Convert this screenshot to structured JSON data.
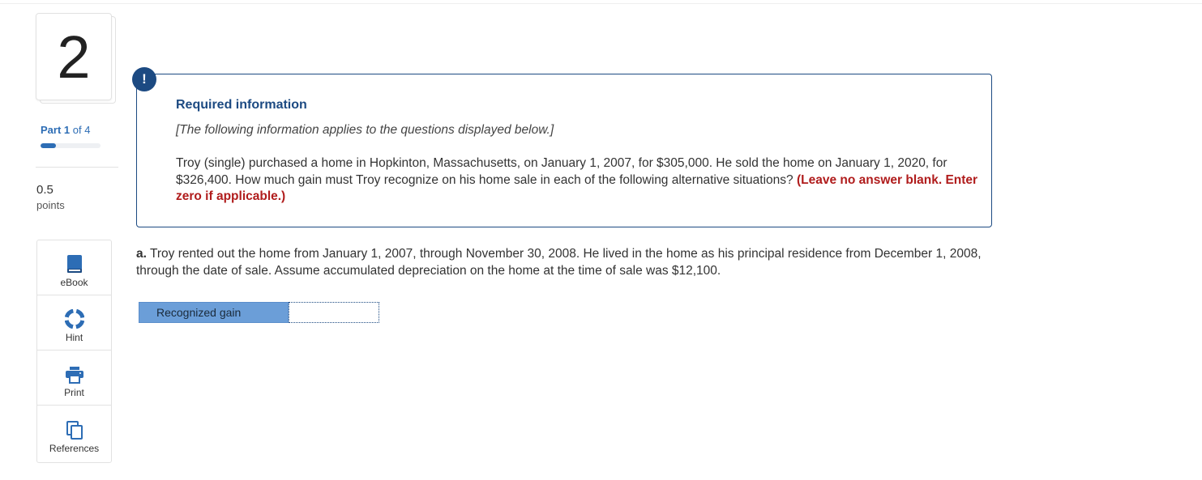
{
  "sidebar": {
    "question_number": "2",
    "part_current": "1",
    "part_of_label": "of 4",
    "part_prefix": "Part",
    "progress_fraction": 0.25,
    "points_value": "0.5",
    "points_label": "points",
    "tools": [
      {
        "label": "eBook",
        "icon": "book-icon"
      },
      {
        "label": "Hint",
        "icon": "lifebuoy-icon"
      },
      {
        "label": "Print",
        "icon": "printer-icon"
      },
      {
        "label": "References",
        "icon": "documents-icon"
      }
    ]
  },
  "info": {
    "alert_icon_glyph": "!",
    "title": "Required information",
    "subtitle": "[The following information applies to the questions displayed below.]",
    "body": "Troy (single) purchased a home in Hopkinton, Massachusetts, on January 1, 2007, for $305,000. He sold the home on January 1, 2020, for $326,400. How much gain must Troy recognize on his home sale in each of the following alternative situations?",
    "instruction": "(Leave no answer blank. Enter zero if applicable.)"
  },
  "question": {
    "prefix": "a.",
    "text": "Troy rented out the home from January 1, 2007, through November 30, 2008. He lived in the home as his principal residence from December 1, 2008, through the date of sale. Assume accumulated depreciation on the home at the time of sale was $12,100."
  },
  "answer": {
    "label": "Recognized gain",
    "value": ""
  },
  "colors": {
    "accent": "#1c4a82",
    "link_blue": "#2d6db5",
    "warning_red": "#b01c1c",
    "answer_label_bg": "#6b9ed8"
  }
}
